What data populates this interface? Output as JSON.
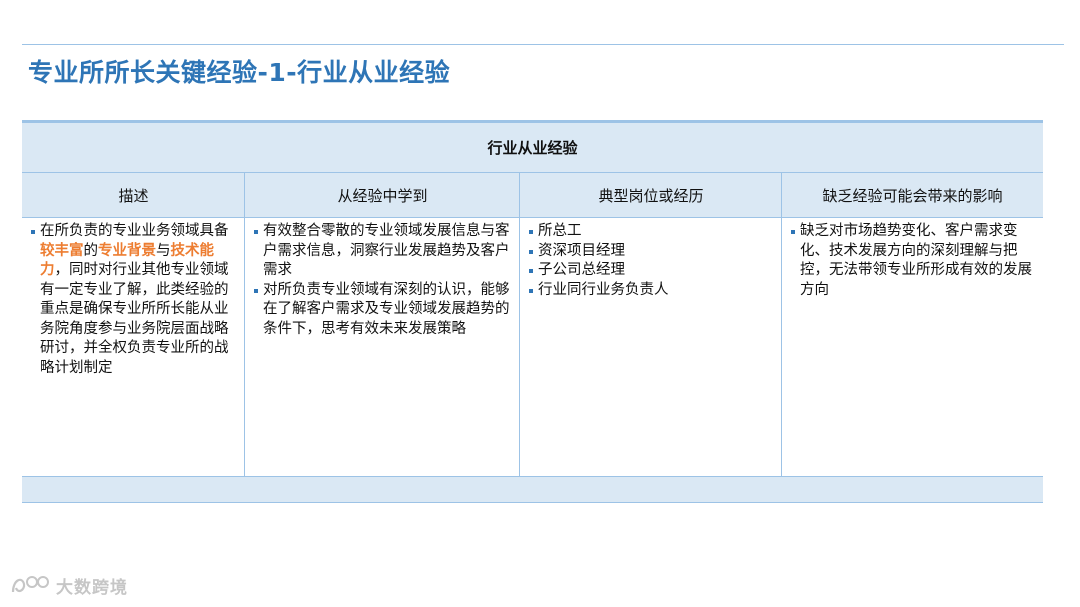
{
  "page": {
    "title": "专业所所长关键经验-1-行业从业经验"
  },
  "table": {
    "header": "行业从业经验",
    "columns": [
      "描述",
      "从经验中学到",
      "典型岗位或经历",
      "缺乏经验可能会带来的影响"
    ],
    "description": {
      "segments": [
        {
          "text": "在所负责的专业业务领域具备",
          "highlight": false
        },
        {
          "text": "较丰富",
          "highlight": true
        },
        {
          "text": "的",
          "highlight": false
        },
        {
          "text": "专业背景",
          "highlight": true
        },
        {
          "text": "与",
          "highlight": false
        },
        {
          "text": "技术能力",
          "highlight": true
        },
        {
          "text": "，同时对行业其他专业领域有一定专业了解，此类经验的重点是确保专业所所长能从业务院角度参与业务院层面战略研讨，并全权负责专业所的战略计划制定",
          "highlight": false
        }
      ]
    },
    "learned": [
      "有效整合零散的专业领域发展信息与客户需求信息，洞察行业发展趋势及客户需求",
      "对所负责专业领域有深刻的认识，能够在了解客户需求及专业领域发展趋势的条件下，思考有效未来发展策略"
    ],
    "positions": [
      "所总工",
      "资深项目经理",
      "子公司总经理",
      "行业同行业务负责人"
    ],
    "impact": [
      "缺乏对市场趋势变化、客户需求变化、技术发展方向的深刻理解与把控，无法带领专业所形成有效的发展方向"
    ]
  },
  "watermark": {
    "text": "大数跨境",
    "icon": "logo-icon"
  },
  "colors": {
    "title": "#2e75b6",
    "header_bg": "#dae8f4",
    "border": "#9dc3e6",
    "highlight": "#ed7d31"
  }
}
